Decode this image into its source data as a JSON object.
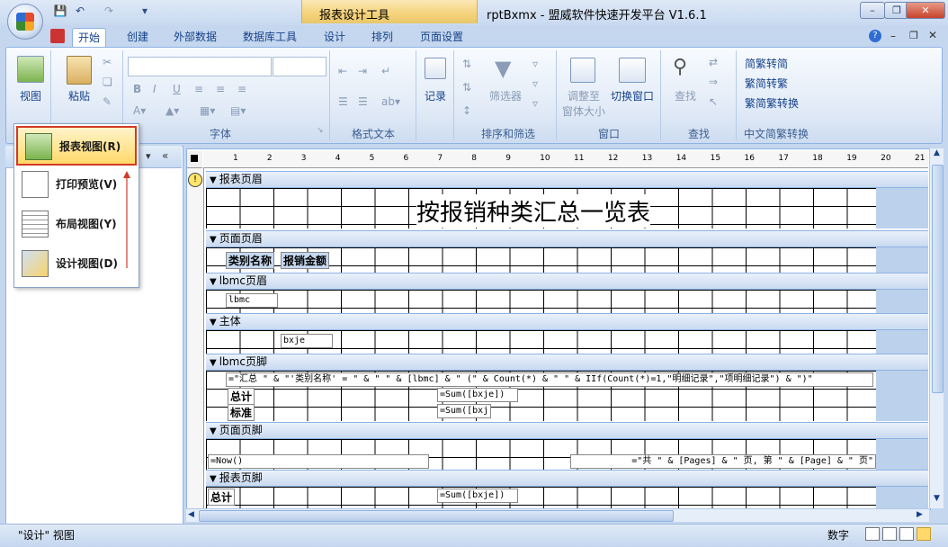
{
  "window": {
    "context_tab_title": "报表设计工具",
    "title": "rptBxmx - 盟威软件快速开发平台 V1.6.1"
  },
  "tabs": [
    "开始",
    "创建",
    "外部数据",
    "数据库工具",
    "设计",
    "排列",
    "页面设置"
  ],
  "ribbon": {
    "view_label": "视图",
    "paste_label": "粘贴",
    "font_group": "字体",
    "format_text_group": "格式文本",
    "records_label": "记录",
    "filter_label": "筛选器",
    "sort_filter_group": "排序和筛选",
    "resize_label": "调整至",
    "resize_label2": "窗体大小",
    "switch_window_label": "切换窗口",
    "window_group": "窗口",
    "find_label": "查找",
    "find_group": "查找",
    "trad_to_simp": "繁转简",
    "simp_to_trad": "简转繁",
    "simp_trad_convert": "简繁转换",
    "chinese_group": "中文简繁转换"
  },
  "view_menu": {
    "items": [
      {
        "label": "报表视图(R)"
      },
      {
        "label": "打印预览(V)"
      },
      {
        "label": "布局视图(Y)"
      },
      {
        "label": "设计视图(D)"
      }
    ]
  },
  "ruler": [
    "1",
    "2",
    "3",
    "4",
    "5",
    "6",
    "7",
    "8",
    "9",
    "10",
    "11",
    "12",
    "13",
    "14",
    "15",
    "16",
    "17",
    "18",
    "19",
    "20",
    "21"
  ],
  "sections": {
    "report_header": "报表页眉",
    "page_header": "页面页眉",
    "group_header": "lbmc页眉",
    "detail": "主体",
    "group_footer": "lbmc页脚",
    "page_footer": "页面页脚",
    "report_footer": "报表页脚"
  },
  "controls": {
    "report_title": "按报销种类汇总一览表",
    "col_category": "类别名称",
    "col_amount": "报销金额",
    "lbmc": "lbmc",
    "bxje": "bxje",
    "group_summary": "=\"汇总 \" & \"'类别名称' = \" & \" \" & [lbmc] & \" (\" & Count(*) & \" \" & IIf(Count(*)=1,\"明细记录\",\"项明细记录\") & \")\"",
    "total_label": "总计",
    "sum_bxje": "=Sum([bxje])",
    "std_label": "标准",
    "sum_bxj": "=Sum([bxj",
    "now": "=Now()",
    "page_expr": "=\"共 \" & [Pages] & \" 页, 第 \" & [Page] & \" 页\"",
    "report_total_label": "总计",
    "report_sum": "=Sum([bxje])"
  },
  "status": {
    "left": "\"设计\" 视图",
    "num": "数字"
  }
}
